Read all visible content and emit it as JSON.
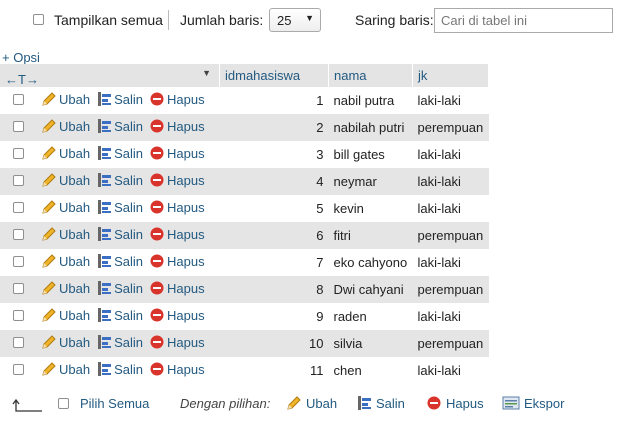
{
  "toolbar": {
    "show_all_label": "Tampilkan semua",
    "rows_label": "Jumlah baris:",
    "rows_value": "25",
    "filter_label": "Saring baris:",
    "filter_placeholder": "Cari di tabel ini"
  },
  "options_link": "+ Opsi",
  "sort_arrows": "←T→",
  "columns": [
    "idmahasiswa",
    "nama",
    "jk"
  ],
  "row_actions": {
    "edit": "Ubah",
    "copy": "Salin",
    "delete": "Hapus"
  },
  "rows": [
    {
      "id": "1",
      "nama": "nabil putra",
      "jk": "laki-laki"
    },
    {
      "id": "2",
      "nama": "nabilah putri",
      "jk": "perempuan"
    },
    {
      "id": "3",
      "nama": "bill gates",
      "jk": "laki-laki"
    },
    {
      "id": "4",
      "nama": "neymar",
      "jk": "laki-laki"
    },
    {
      "id": "5",
      "nama": "kevin",
      "jk": "laki-laki"
    },
    {
      "id": "6",
      "nama": "fitri",
      "jk": "perempuan"
    },
    {
      "id": "7",
      "nama": "eko cahyono",
      "jk": "laki-laki"
    },
    {
      "id": "8",
      "nama": "Dwi cahyani",
      "jk": "perempuan"
    },
    {
      "id": "9",
      "nama": "raden",
      "jk": "laki-laki"
    },
    {
      "id": "10",
      "nama": "silvia",
      "jk": "perempuan"
    },
    {
      "id": "11",
      "nama": "chen",
      "jk": "laki-laki"
    }
  ],
  "bottom": {
    "select_all": "Pilih Semua",
    "with_selected": "Dengan pilihan:",
    "edit": "Ubah",
    "copy": "Salin",
    "delete": "Hapus",
    "export": "Ekspor"
  },
  "colors": {
    "link": "#235a81",
    "header_bg": "#e4e4e4",
    "row_alt": "#e5e5e5",
    "delete_red": "#d9342b"
  }
}
